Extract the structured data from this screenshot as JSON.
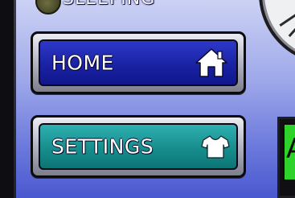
{
  "status": {
    "label": "SLEEPING",
    "icon": "status-indicator-icon"
  },
  "nav": {
    "home": {
      "label": "HOME",
      "icon": "home-icon"
    },
    "settings": {
      "label": "SETTINGS",
      "icon": "shirt-icon"
    }
  },
  "right_panel": {
    "text": "A"
  },
  "colors": {
    "background_top": "#ccd2f4",
    "background_bottom": "#4a58cf",
    "home_button": "#1a22a4",
    "settings_button": "#178d8d",
    "panel_green": "#2fd22a"
  }
}
